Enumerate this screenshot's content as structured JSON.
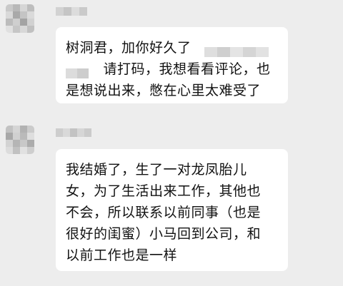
{
  "messages": [
    {
      "lines": [
        "树洞君，加你好久了",
        "请打码，我想看看评论，也",
        "是想说出来，憋在心里太难受了"
      ]
    },
    {
      "lines": [
        "我结婚了，生了一对龙凤胎儿",
        "女，为了生活出来工作，其他也",
        "不会，所以联系以前同事（也是",
        "很好的闺蜜）小马回到公司，和",
        "以前工作也是一样"
      ]
    }
  ]
}
